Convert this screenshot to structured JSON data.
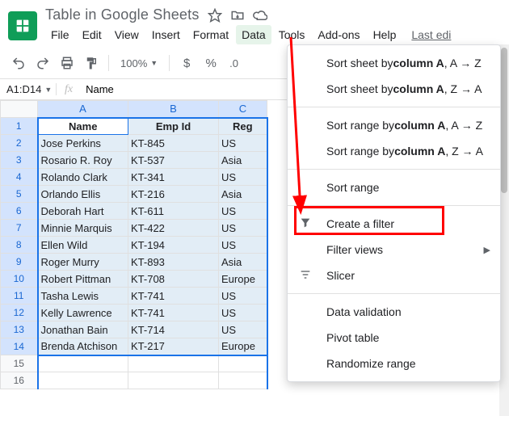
{
  "header": {
    "doc_title": "Table in Google Sheets",
    "menus": [
      "File",
      "Edit",
      "View",
      "Insert",
      "Format",
      "Data",
      "Tools",
      "Add-ons",
      "Help"
    ],
    "active_menu_index": 5,
    "last_edit": "Last edi"
  },
  "toolbar": {
    "zoom": "100%",
    "currency": "$",
    "percent": "%",
    "decimal0": ".0"
  },
  "fx_bar": {
    "cell_ref": "A1:D14",
    "fx_label": "fx",
    "value": "Name"
  },
  "sheet": {
    "columns": [
      "A",
      "B",
      "C"
    ],
    "col_c_label": "C",
    "rows": [
      {
        "n": "1",
        "name": "Name",
        "emp": "Emp Id",
        "region": "Reg",
        "header": true
      },
      {
        "n": "2",
        "name": "Jose Perkins",
        "emp": "KT-845",
        "region": "US"
      },
      {
        "n": "3",
        "name": "Rosario R. Roy",
        "emp": "KT-537",
        "region": "Asia"
      },
      {
        "n": "4",
        "name": "Rolando Clark",
        "emp": "KT-341",
        "region": "US"
      },
      {
        "n": "5",
        "name": "Orlando Ellis",
        "emp": "KT-216",
        "region": "Asia"
      },
      {
        "n": "6",
        "name": "Deborah Hart",
        "emp": "KT-611",
        "region": "US"
      },
      {
        "n": "7",
        "name": "Minnie Marquis",
        "emp": "KT-422",
        "region": "US"
      },
      {
        "n": "8",
        "name": "Ellen Wild",
        "emp": "KT-194",
        "region": "US"
      },
      {
        "n": "9",
        "name": "Roger Murry",
        "emp": "KT-893",
        "region": "Asia"
      },
      {
        "n": "10",
        "name": "Robert Pittman",
        "emp": "KT-708",
        "region": "Europe"
      },
      {
        "n": "11",
        "name": "Tasha Lewis",
        "emp": "KT-741",
        "region": "US"
      },
      {
        "n": "12",
        "name": "Kelly Lawrence",
        "emp": "KT-741",
        "region": "US"
      },
      {
        "n": "13",
        "name": "Jonathan Bain",
        "emp": "KT-714",
        "region": "US"
      },
      {
        "n": "14",
        "name": "Brenda Atchison",
        "emp": "KT-217",
        "region": "Europe"
      },
      {
        "n": "15",
        "name": "",
        "emp": "",
        "region": ""
      },
      {
        "n": "16",
        "name": "",
        "emp": "",
        "region": ""
      }
    ]
  },
  "dropdown": {
    "sort_sheet_az_pre": "Sort sheet by ",
    "sort_sheet_az_b": "column A",
    "sort_sheet_az_post": ", A → Z",
    "sort_sheet_za_pre": "Sort sheet by ",
    "sort_sheet_za_b": "column A",
    "sort_sheet_za_post": ", Z → A",
    "sort_range_az_pre": "Sort range by ",
    "sort_range_az_b": "column A",
    "sort_range_az_post": ", A → Z",
    "sort_range_za_pre": "Sort range by ",
    "sort_range_za_b": "column A",
    "sort_range_za_post": ", Z → A",
    "sort_range": "Sort range",
    "create_filter": "Create a filter",
    "filter_views": "Filter views",
    "slicer": "Slicer",
    "data_validation": "Data validation",
    "pivot_table": "Pivot table",
    "randomize": "Randomize range"
  }
}
